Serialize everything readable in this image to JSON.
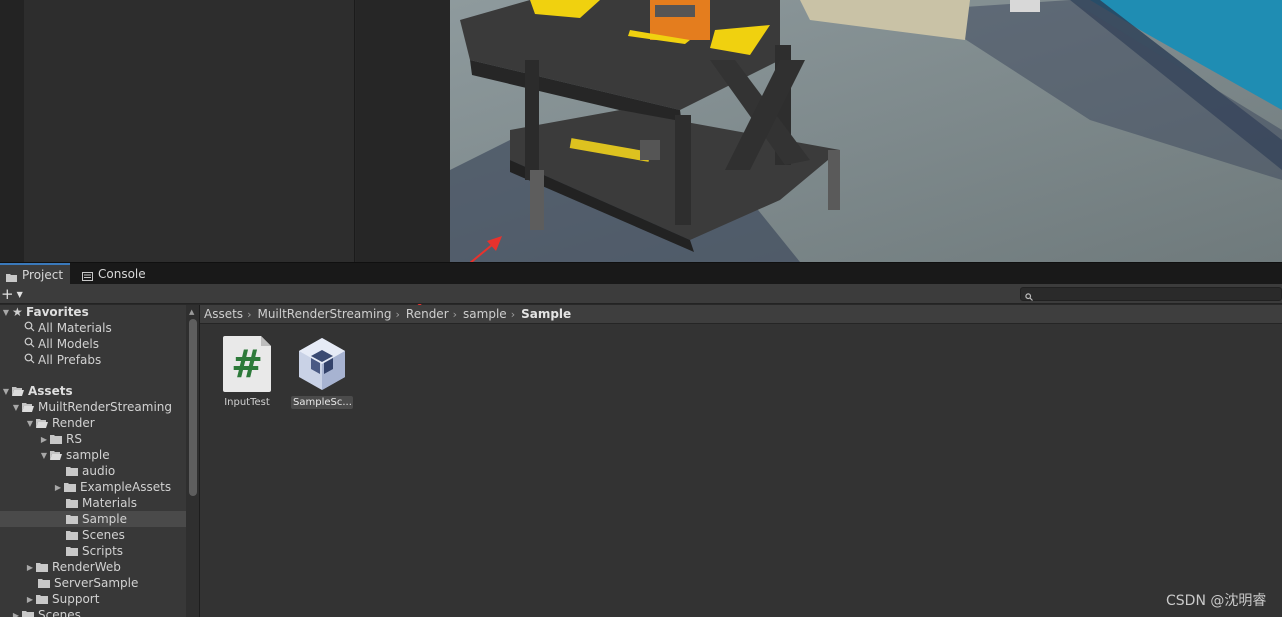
{
  "tabs": [
    {
      "label": "Project",
      "icon": "folder-icon",
      "active": true
    },
    {
      "label": "Console",
      "icon": "console-icon",
      "active": false
    }
  ],
  "toolbar": {
    "add_symbol": "+",
    "dropdown_symbol": "▼"
  },
  "tree": {
    "favorites_label": "Favorites",
    "favorites": [
      "All Materials",
      "All Models",
      "All Prefabs"
    ],
    "assets_label": "Assets",
    "items": [
      {
        "label": "MuiltRenderStreaming"
      },
      {
        "label": "Render"
      },
      {
        "label": "RS"
      },
      {
        "label": "sample"
      },
      {
        "label": "audio"
      },
      {
        "label": "ExampleAssets"
      },
      {
        "label": "Materials"
      },
      {
        "label": "Sample",
        "selected": true
      },
      {
        "label": "Scenes"
      },
      {
        "label": "Scripts"
      },
      {
        "label": "RenderWeb"
      },
      {
        "label": "ServerSample"
      },
      {
        "label": "Support"
      },
      {
        "label": "Scenes"
      }
    ]
  },
  "breadcrumb": [
    "Assets",
    "MuiltRenderStreaming",
    "Render",
    "sample",
    "Sample"
  ],
  "assets": [
    {
      "label": "InputTest",
      "icon": "csharp-script-icon",
      "glyph": "#",
      "selected": false
    },
    {
      "label": "SampleSc...",
      "icon": "unity-scene-icon",
      "selected": true
    }
  ],
  "watermark": "CSDN @沈明睿",
  "colors": {
    "accent": "#3a79bb",
    "annotation_arrow": "#e8322d",
    "script_hash": "#2d7a3a"
  }
}
